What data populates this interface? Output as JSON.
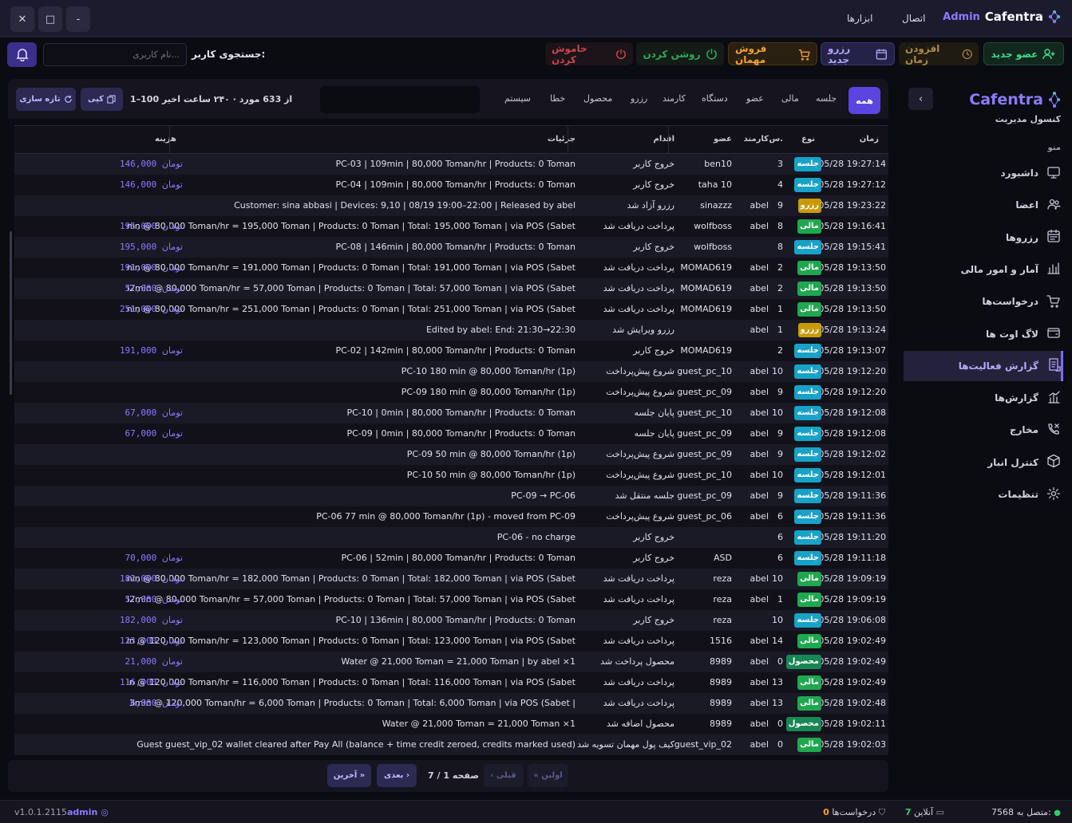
{
  "window": {
    "close": "✕",
    "maximize": "□",
    "minimize": "-"
  },
  "brand": {
    "admin": "Admin",
    "name": "Cafentra"
  },
  "topnav": {
    "connection": "اتصال",
    "tools": "ابزارها"
  },
  "toolbar": {
    "new_member": "عضو جدید",
    "add_time": "افزودن زمان",
    "new_reservation": "رزرو جدید",
    "guest_sale": "فروش مهمان",
    "power_on": "روشن کردن",
    "power_off": "خاموش کردن",
    "search_label": "جستجوی کاربر:",
    "search_placeholder": "نام کاربری..."
  },
  "sidebar": {
    "title": "Cafentra",
    "subtitle": "کنسول مدیریت",
    "menu_label": "منو",
    "collapse": "‹",
    "items": [
      {
        "label": "داشبورد",
        "icon": "monitor-icon"
      },
      {
        "label": "اعضا",
        "icon": "users-icon"
      },
      {
        "label": "رزروها",
        "icon": "calendar-icon"
      },
      {
        "label": "آمار و امور مالی",
        "icon": "bar-chart-icon"
      },
      {
        "label": "درخواست‌ها",
        "icon": "cart-icon"
      },
      {
        "label": "لاگ اوت ها",
        "icon": "wallet-icon"
      },
      {
        "label": "گزارش فعالیت‌ها",
        "icon": "activity-report-icon"
      },
      {
        "label": "گزارش‌ها",
        "icon": "reports-icon"
      },
      {
        "label": "مخارج",
        "icon": "phone-x-icon"
      },
      {
        "label": "کنترل انبار",
        "icon": "box-icon"
      },
      {
        "label": "تنظیمات",
        "icon": "gear-icon"
      }
    ]
  },
  "filters": {
    "tabs": [
      "همه",
      "جلسه",
      "مالی",
      "عضو",
      "دستگاه",
      "کارمند",
      "رزرو",
      "محصول",
      "خطا",
      "سیستم"
    ],
    "summary": "1–100 از 633 مورد · ۲۴۰ ساعت اخیر",
    "copy": "کپی",
    "refresh": "تازه سازی"
  },
  "table": {
    "headers": {
      "time": "زمان",
      "type": "نوع",
      "num": "س.",
      "staff": "کارمند",
      "member": "عضو",
      "action": "اقدام",
      "details": "جزئیات",
      "cost": "هزینه"
    },
    "currency": "تومان",
    "type_colors": {
      "جلسه": "#17a2c8",
      "مالی": "#1fa84f",
      "رزرو": "#c99a08",
      "محصول": "#198754"
    },
    "rows": [
      {
        "time": "05/28 19:27:14",
        "type": "جلسه",
        "num": "3",
        "staff": "",
        "member": "ben10",
        "action": "خروج کاربر",
        "details": "PC-03 | 109min | 80,000 Toman/hr | Products: 0 Toman",
        "cost": "146,000"
      },
      {
        "time": "05/28 19:27:12",
        "type": "جلسه",
        "num": "4",
        "staff": "",
        "member": "taha 10",
        "action": "خروج کاربر",
        "details": "PC-04 | 109min | 80,000 Toman/hr | Products: 0 Toman",
        "cost": "146,000"
      },
      {
        "time": "05/28 19:23:22",
        "type": "رزرو",
        "num": "9",
        "staff": "abel",
        "member": "sinazzz",
        "action": "رزرو آزاد شد",
        "details": "Customer: sina abbasi | Devices: 9,10 | 08/19 19:00–22:00 | Released by abel",
        "cost": ""
      },
      {
        "time": "05/28 19:16:41",
        "type": "مالی",
        "num": "8",
        "staff": "abel",
        "member": "wolfboss",
        "action": "پرداخت دریافت شد",
        "details": "nin @ 80,000 Toman/hr = 195,000 Toman | Products: 0 Toman | Total: 195,000 Toman | via POS (Sabet",
        "cost": "195,000"
      },
      {
        "time": "05/28 19:15:41",
        "type": "جلسه",
        "num": "8",
        "staff": "",
        "member": "wolfboss",
        "action": "خروج کاربر",
        "details": "PC-08 | 146min | 80,000 Toman/hr | Products: 0 Toman",
        "cost": "195,000"
      },
      {
        "time": "05/28 19:13:50",
        "type": "مالی",
        "num": "2",
        "staff": "abel",
        "member": "MOMAD619",
        "action": "پرداخت دریافت شد",
        "details": "nin @ 80,000 Toman/hr = 191,000 Toman | Products: 0 Toman | Total: 191,000 Toman | via POS (Sabet",
        "cost": "191,000"
      },
      {
        "time": "05/28 19:13:50",
        "type": "مالی",
        "num": "2",
        "staff": "abel",
        "member": "MOMAD619",
        "action": "پرداخت دریافت شد",
        "details": "l2min @ 80,000 Toman/hr = 57,000 Toman | Products: 0 Toman | Total: 57,000 Toman | via POS (Sabet",
        "cost": "57,000"
      },
      {
        "time": "05/28 19:13:50",
        "type": "مالی",
        "num": "1",
        "staff": "abel",
        "member": "MOMAD619",
        "action": "پرداخت دریافت شد",
        "details": "nin @ 80,000 Toman/hr = 251,000 Toman | Products: 0 Toman | Total: 251,000 Toman | via POS (Sabet",
        "cost": "251,000"
      },
      {
        "time": "05/28 19:13:24",
        "type": "رزرو",
        "num": "1",
        "staff": "abel",
        "member": "",
        "action": "رزرو ویرایش شد",
        "details": "Edited by abel: End: 21:30→22:30",
        "cost": ""
      },
      {
        "time": "05/28 19:13:07",
        "type": "جلسه",
        "num": "2",
        "staff": "",
        "member": "MOMAD619",
        "action": "خروج کاربر",
        "details": "PC-02 | 142min | 80,000 Toman/hr | Products: 0 Toman",
        "cost": "191,000"
      },
      {
        "time": "05/28 19:12:20",
        "type": "جلسه",
        "num": "10",
        "staff": "abel",
        "member": "guest_pc_10",
        "action": "شروع پیش‌پرداخت",
        "details": "(PC-10 180 min @ 80,000 Toman/hr (1p",
        "cost": ""
      },
      {
        "time": "05/28 19:12:20",
        "type": "جلسه",
        "num": "9",
        "staff": "abel",
        "member": "guest_pc_09",
        "action": "شروع پیش‌پرداخت",
        "details": "(PC-09 180 min @ 80,000 Toman/hr (1p",
        "cost": ""
      },
      {
        "time": "05/28 19:12:08",
        "type": "جلسه",
        "num": "10",
        "staff": "abel",
        "member": "guest_pc_10",
        "action": "پایان جلسه",
        "details": "PC-10 | 0min | 80,000 Toman/hr | Products: 0 Toman",
        "cost": "67,000"
      },
      {
        "time": "05/28 19:12:08",
        "type": "جلسه",
        "num": "9",
        "staff": "abel",
        "member": "guest_pc_09",
        "action": "پایان جلسه",
        "details": "PC-09 | 0min | 80,000 Toman/hr | Products: 0 Toman",
        "cost": "67,000"
      },
      {
        "time": "05/28 19:12:02",
        "type": "جلسه",
        "num": "9",
        "staff": "abel",
        "member": "guest_pc_09",
        "action": "شروع پیش‌پرداخت",
        "details": "(PC-09 50 min @ 80,000 Toman/hr (1p",
        "cost": ""
      },
      {
        "time": "05/28 19:12:01",
        "type": "جلسه",
        "num": "10",
        "staff": "abel",
        "member": "guest_pc_10",
        "action": "شروع پیش‌پرداخت",
        "details": "(PC-10 50 min @ 80,000 Toman/hr (1p",
        "cost": ""
      },
      {
        "time": "05/28 19:11:36",
        "type": "جلسه",
        "num": "9",
        "staff": "abel",
        "member": "guest_pc_09",
        "action": "جلسه منتقل شد",
        "details": "PC-09 → PC-06",
        "cost": ""
      },
      {
        "time": "05/28 19:11:36",
        "type": "جلسه",
        "num": "6",
        "staff": "abel",
        "member": "guest_pc_06",
        "action": "شروع پیش‌پرداخت",
        "details": "PC-06 77 min @ 80,000 Toman/hr (1p) - moved from PC-09",
        "cost": ""
      },
      {
        "time": "05/28 19:11:20",
        "type": "جلسه",
        "num": "6",
        "staff": "",
        "member": "",
        "action": "خروج کاربر",
        "details": "PC-06 - no charge",
        "cost": ""
      },
      {
        "time": "05/28 19:11:18",
        "type": "جلسه",
        "num": "6",
        "staff": "",
        "member": "ASD",
        "action": "خروج کاربر",
        "details": "PC-06 | 52min | 80,000 Toman/hr | Products: 0 Toman",
        "cost": "70,000"
      },
      {
        "time": "05/28 19:09:19",
        "type": "مالی",
        "num": "10",
        "staff": "abel",
        "member": "reza",
        "action": "پرداخت دریافت شد",
        "details": "nin @ 80,000 Toman/hr = 182,000 Toman | Products: 0 Toman | Total: 182,000 Toman | via POS (Sabet",
        "cost": "182,000"
      },
      {
        "time": "05/28 19:09:19",
        "type": "مالی",
        "num": "1",
        "staff": "abel",
        "member": "reza",
        "action": "پرداخت دریافت شد",
        "details": "l2min @ 80,000 Toman/hr = 57,000 Toman | Products: 0 Toman | Total: 57,000 Toman | via POS (Sabet",
        "cost": "57,000"
      },
      {
        "time": "05/28 19:06:08",
        "type": "جلسه",
        "num": "10",
        "staff": "",
        "member": "reza",
        "action": "خروج کاربر",
        "details": "PC-10 | 136min | 80,000 Toman/hr | Products: 0 Toman",
        "cost": "182,000"
      },
      {
        "time": "05/28 19:02:49",
        "type": "مالی",
        "num": "14",
        "staff": "abel",
        "member": "1516",
        "action": "پرداخت دریافت شد",
        "details": "in @ 120,000 Toman/hr = 123,000 Toman | Products: 0 Toman | Total: 123,000 Toman | via POS (Sabet",
        "cost": "123,000"
      },
      {
        "time": "05/28 19:02:49",
        "type": "محصول",
        "num": "0",
        "staff": "abel",
        "member": "8989",
        "action": "محصول پرداخت شد",
        "details": "Water @ 21,000 Toman = 21,000 Toman | by abel ×1",
        "cost": "21,000"
      },
      {
        "time": "05/28 19:02:49",
        "type": "مالی",
        "num": "13",
        "staff": "abel",
        "member": "8989",
        "action": "پرداخت دریافت شد",
        "details": "in @ 120,000 Toman/hr = 116,000 Toman | Products: 0 Toman | Total: 116,000 Toman | via POS (Sabet",
        "cost": "116,000"
      },
      {
        "time": "05/28 19:02:48",
        "type": "مالی",
        "num": "13",
        "staff": "abel",
        "member": "8989",
        "action": "پرداخت دریافت شد",
        "details": "| 3min @ 120,000 Toman/hr = 6,000 Toman | Products: 0 Toman | Total: 6,000 Toman | via POS (Sabet",
        "cost": "6,000"
      },
      {
        "time": "05/28 19:02:11",
        "type": "محصول",
        "num": "0",
        "staff": "abel",
        "member": "8989",
        "action": "محصول اضافه شد",
        "details": "Water @ 21,000 Toman = 21,000 Toman ×1",
        "cost": ""
      },
      {
        "time": "05/28 19:02:03",
        "type": "مالی",
        "num": "0",
        "staff": "abel",
        "member": "guest_vip_02",
        "action": "کیف پول مهمان تسویه شد",
        "details": "(Guest guest_vip_02 wallet cleared after Pay All (balance + time credit zeroed, credits marked used",
        "cost": ""
      }
    ]
  },
  "pager": {
    "first": "« اولین",
    "prev": "‹ قبلی",
    "page": "صفحه 1 / 7",
    "next": "بعدی ›",
    "last": "آخرین »"
  },
  "status": {
    "connected": "متصل به 7568:",
    "online_count": "7",
    "online_label": "آنلاین",
    "requests_count": "0",
    "requests_label": "درخواست‌ها",
    "user": "admin",
    "version": "v1.0.1.2115"
  }
}
